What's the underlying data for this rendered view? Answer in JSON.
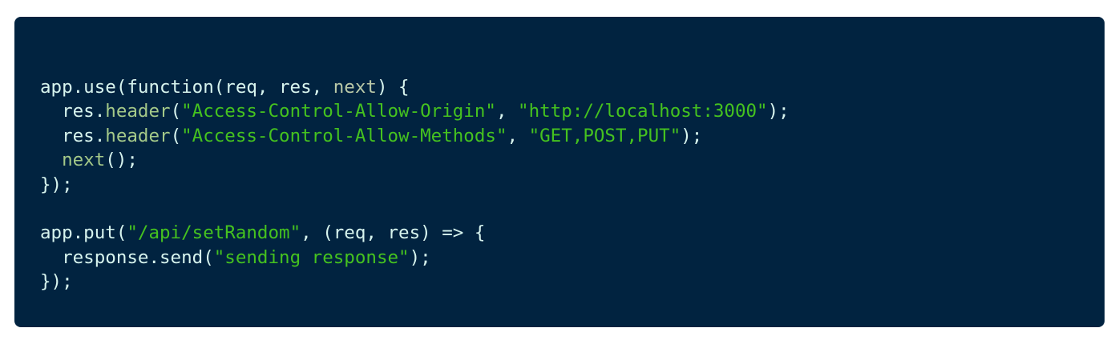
{
  "colors": {
    "background": "#012340",
    "plain": "#d7f4ee",
    "string": "#45c21f",
    "function": "#a4c989",
    "param": "#b9c9a8"
  },
  "code": {
    "lines": [
      [
        {
          "t": "app.use(function(req, res, ",
          "c": "plain"
        },
        {
          "t": "next",
          "c": "param"
        },
        {
          "t": ") {",
          "c": "plain"
        }
      ],
      [
        {
          "t": "  res.",
          "c": "plain"
        },
        {
          "t": "header",
          "c": "fn"
        },
        {
          "t": "(",
          "c": "plain"
        },
        {
          "t": "\"Access-Control-Allow-Origin\"",
          "c": "str"
        },
        {
          "t": ", ",
          "c": "plain"
        },
        {
          "t": "\"http://localhost:3000\"",
          "c": "str"
        },
        {
          "t": ");",
          "c": "plain"
        }
      ],
      [
        {
          "t": "  res.",
          "c": "plain"
        },
        {
          "t": "header",
          "c": "fn"
        },
        {
          "t": "(",
          "c": "plain"
        },
        {
          "t": "\"Access-Control-Allow-Methods\"",
          "c": "str"
        },
        {
          "t": ", ",
          "c": "plain"
        },
        {
          "t": "\"GET,POST,PUT\"",
          "c": "str"
        },
        {
          "t": ");",
          "c": "plain"
        }
      ],
      [
        {
          "t": "  ",
          "c": "plain"
        },
        {
          "t": "next",
          "c": "fn"
        },
        {
          "t": "();",
          "c": "plain"
        }
      ],
      [
        {
          "t": "});",
          "c": "plain"
        }
      ],
      [],
      [
        {
          "t": "app.put(",
          "c": "plain"
        },
        {
          "t": "\"/api/setRandom\"",
          "c": "str"
        },
        {
          "t": ", (req, res) => {",
          "c": "plain"
        }
      ],
      [
        {
          "t": "  response.send(",
          "c": "plain"
        },
        {
          "t": "\"sending response\"",
          "c": "str"
        },
        {
          "t": ");",
          "c": "plain"
        }
      ],
      [
        {
          "t": "});",
          "c": "plain"
        }
      ]
    ]
  }
}
